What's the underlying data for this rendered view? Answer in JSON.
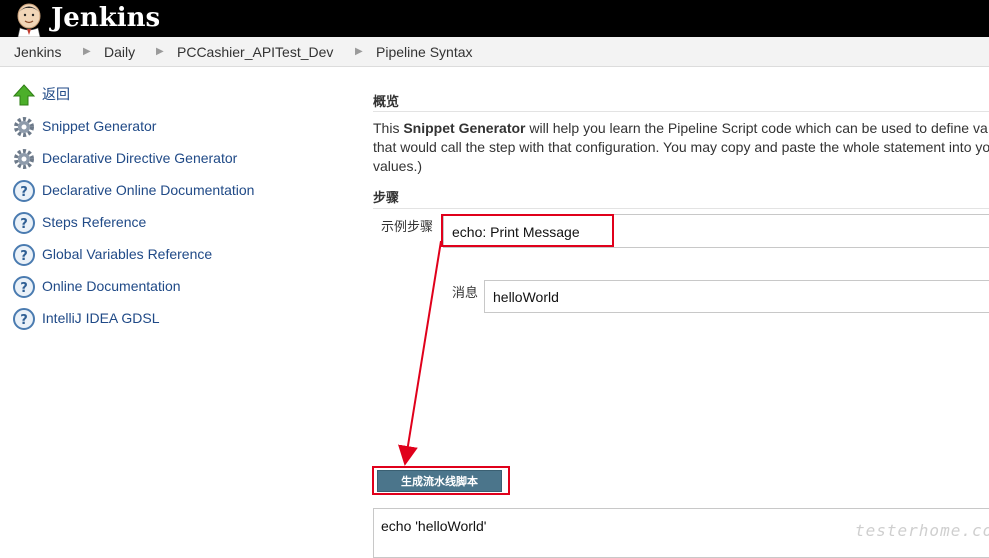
{
  "header": {
    "brand": "Jenkins"
  },
  "breadcrumb": {
    "items": [
      "Jenkins",
      "Daily",
      "PCCashier_APITest_Dev",
      "Pipeline Syntax"
    ]
  },
  "sidebar": {
    "items": [
      {
        "label": "返回",
        "icon": "up-arrow-icon"
      },
      {
        "label": "Snippet Generator",
        "icon": "gear-icon"
      },
      {
        "label": "Declarative Directive Generator",
        "icon": "gear-icon"
      },
      {
        "label": "Declarative Online Documentation",
        "icon": "help-icon"
      },
      {
        "label": "Steps Reference",
        "icon": "help-icon"
      },
      {
        "label": "Global Variables Reference",
        "icon": "help-icon"
      },
      {
        "label": "Online Documentation",
        "icon": "help-icon"
      },
      {
        "label": "IntelliJ IDEA GDSL",
        "icon": "help-icon"
      }
    ]
  },
  "main": {
    "overview_title": "概览",
    "overview_intro": "This ",
    "overview_bold": "Snippet Generator",
    "overview_rest": " will help you learn the Pipeline Script code which can be used to define va",
    "overview_line2": "that would call the step with that configuration. You may copy and paste the whole statement into yo",
    "overview_line3": "values.)",
    "steps_title": "步骤",
    "sample_step_label": "示例步骤",
    "sample_step_value": "echo: Print Message",
    "message_label": "消息",
    "message_value": "helloWorld",
    "generate_button": "生成流水线脚本",
    "output_script": "echo 'helloWorld'"
  },
  "colors": {
    "header_bg": "#000000",
    "link": "#204a87",
    "button_bg": "#4b758b",
    "highlight": "#e0001b"
  },
  "watermark": "testerhome.com"
}
